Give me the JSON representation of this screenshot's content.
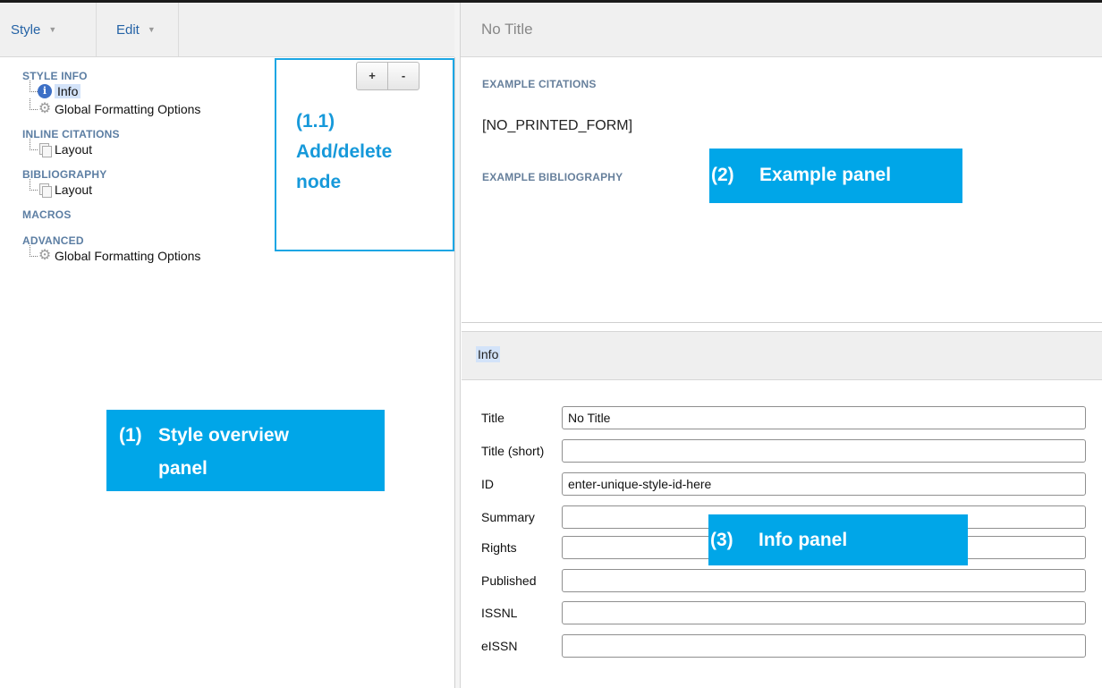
{
  "menu": {
    "style_label": "Style",
    "edit_label": "Edit",
    "caret_icon": "caret-down-icon"
  },
  "title_bar": {
    "title": "No Title"
  },
  "tree": {
    "sections": [
      {
        "heading": "STYLE INFO"
      },
      {
        "heading": "INLINE CITATIONS"
      },
      {
        "heading": "BIBLIOGRAPHY"
      },
      {
        "heading": "MACROS"
      },
      {
        "heading": "ADVANCED"
      }
    ],
    "nodes": {
      "info": {
        "label": "Info",
        "icon": "info-icon",
        "selected": true
      },
      "global_formatting": {
        "label": "Global Formatting Options",
        "icon": "gear-icon"
      },
      "inline_layout": {
        "label": "Layout",
        "icon": "pages-icon"
      },
      "bib_layout": {
        "label": "Layout",
        "icon": "pages-icon"
      },
      "advanced_global": {
        "label": "Global Formatting Options",
        "icon": "gear-icon"
      }
    }
  },
  "node_buttons": {
    "add": "+",
    "delete": "-"
  },
  "annotations": {
    "add_delete": [
      "(1.1)",
      "Add/delete",
      "node"
    ],
    "style_overview_num": "(1)",
    "style_overview_text": [
      "Style overview",
      "panel"
    ],
    "example_num": "(2)",
    "example_text": "Example panel",
    "info_num": "(3)",
    "info_text": "Info panel",
    "colors": {
      "callout_fill": "#00a6e8",
      "callout_outline": "#1ba6e4"
    }
  },
  "example_panel": {
    "citations_heading": "EXAMPLE CITATIONS",
    "citations_text": "[NO_PRINTED_FORM]",
    "bibliography_heading": "EXAMPLE BIBLIOGRAPHY"
  },
  "info_panel": {
    "header": "Info",
    "fields": [
      {
        "label": "Title",
        "value": "No Title"
      },
      {
        "label": "Title (short)",
        "value": ""
      },
      {
        "label": "ID",
        "value": "enter-unique-style-id-here"
      },
      {
        "label": "Summary",
        "value": ""
      },
      {
        "label": "Rights",
        "value": ""
      },
      {
        "label": "Published",
        "value": ""
      },
      {
        "label": "ISSNL",
        "value": ""
      },
      {
        "label": "eISSN",
        "value": ""
      }
    ]
  }
}
